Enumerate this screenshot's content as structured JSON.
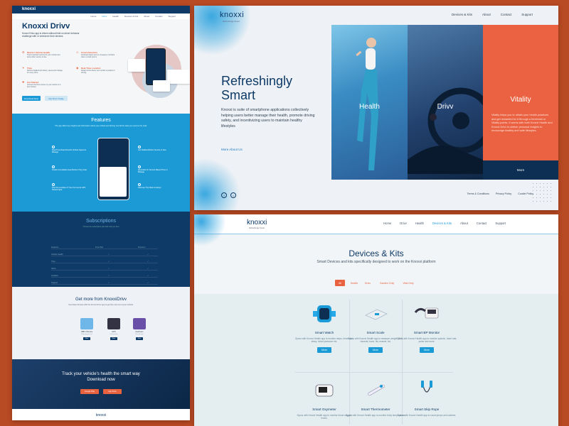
{
  "panel1": {
    "logo": "knoxxi",
    "nav": [
      "Home",
      "Drivv",
      "Health",
      "Devices & Kits",
      "About",
      "Contact",
      "Support"
    ],
    "hero_title": "Knoxxi Drivv",
    "hero_desc": "Knoxxi Drivv app is driven without limit on driver behavior challenge with or whenever their devices.",
    "features_left": [
      {
        "title": "Monitor Vehicle Health",
        "desc": "Track important metrics for your vehicle and know when service is due."
      },
      {
        "title": "Trips",
        "desc": "Review detailed trip history, speed and mileage for every drive."
      },
      {
        "title": "Get Started",
        "desc": "Connect the Drivv device to your vehicle in a few minutes."
      }
    ],
    "features_right": [
      {
        "title": "Crash Detection",
        "desc": "Automatic alerts sent to emergency contacts when a crash occurs."
      },
      {
        "title": "Real Time Location",
        "desc": "Always know where your vehicle is parked or driving."
      }
    ],
    "btn_primary": "Download Now",
    "btn_secondary": "Get Drivv Today",
    "features_title": "Features",
    "features_sub": "The app offers key insights and information about your vehicle and driving. Get all the data you need on the road.",
    "feature_items": [
      "Real Time Data Records Vehicle Speed & Mileage",
      "Predict Immediate Issue Before They Arise",
      "Find the Location of Your Car via Its GPS Parked Spot",
      "Get Notified Before Service Is Due",
      "Reminder for Service Based Time or Mileage",
      "Discover Trip Data & History"
    ],
    "subs_title": "Subscriptions",
    "subs_sub": "Choose the subscription plan that suits you best",
    "subs_cols": [
      "Features",
      "Free Plan",
      "Premium"
    ],
    "subs_rows": [
      "Vehicle Health",
      "Trips",
      "Alerts",
      "Location",
      "Support"
    ],
    "more_title": "Get more from KnoxxiDrivv",
    "more_sub": "Use these devices with the Knoxxi Drivv app to get the most out of your vehicle.",
    "devices": [
      {
        "name": "OBD II Device",
        "desc": "Plug into your car"
      },
      {
        "name": "GPS",
        "desc": "Live location"
      },
      {
        "name": "Dashcam",
        "desc": "Record trips"
      }
    ],
    "device_btn": "More",
    "dl_title_1": "Track your vehicle's health the smart way",
    "dl_title_2": "Download now",
    "store_1": "Google Play",
    "store_2": "App Store",
    "footer_logo": "knoxxi"
  },
  "panel2": {
    "logo": "knoxxi",
    "logo_sub": "Refreshingly Smart",
    "nav": [
      "Devices & Kits",
      "About",
      "Contact",
      "Support"
    ],
    "headline_1": "Refreshingly",
    "headline_2": "Smart",
    "description": "Knoxxi is suite of smartphone applications collectively helping users better manage their health, promote driving safety, and incentivizing users to maintain healthy lifestyles",
    "more_link": "More About Us",
    "tiles": [
      "Health",
      "Drivv",
      "Vitality"
    ],
    "vitality_desc": "Vitality helps you to obtain your health practices and get rewarded for it through a threshold or Vitality points. It works with both Knoxxi Health and Knoxxi Drivv to deliver personal insights to encourage healthy and safe lifestyles.",
    "vitality_more": "More",
    "social": [
      "f",
      "t"
    ],
    "footer_links": [
      "Terms & Conditions",
      "Privacy Policy",
      "Cookie Policy"
    ]
  },
  "panel3": {
    "logo": "knoxxi",
    "logo_sub": "Refreshingly Smart",
    "nav": [
      "Home",
      "Drivv",
      "Health",
      "Devices & Kits",
      "About",
      "Contact",
      "Support"
    ],
    "active_nav": "Devices & Kits",
    "title": "Devices & Kits",
    "subtitle": "Smart Devices and kits specifically designed to work on the Knoxxi platform",
    "filters": [
      "All",
      "Health",
      "Drivv",
      "Garden Only",
      "Vital Only"
    ],
    "products": [
      {
        "name": "Smart Watch",
        "desc": "Syncs with Knoxxi Health app to monitor steps, heart rate, sleep, blood pressure etc.",
        "btn": "More"
      },
      {
        "name": "Smart Scale",
        "desc": "Syncs with Knoxxi Health app to measure weight, BMI, visceral, bone, fat, muscle, fat.",
        "btn": "More"
      },
      {
        "name": "Smart BP Monitor",
        "desc": "Syncs with Knoxxi Health app to monitor systolic, heart rate, pulse and more.",
        "btn": "More"
      },
      {
        "name": "Smart Oxymeter",
        "desc": "Syncs with Knoxxi Health app to monitor blood oxygen levels.",
        "btn": "More"
      },
      {
        "name": "Smart Thermometer",
        "desc": "Syncs with Knoxxi Health app to monitor body temperature.",
        "btn": "More"
      },
      {
        "name": "Smart Skip Rope",
        "desc": "Syncs with Knoxxi Health app to count jumps and calories.",
        "btn": "More"
      }
    ]
  },
  "colors": {
    "navy": "#0d3a66",
    "blue": "#1a9ad6",
    "orange": "#e8623f",
    "frame": "#b84a24"
  }
}
